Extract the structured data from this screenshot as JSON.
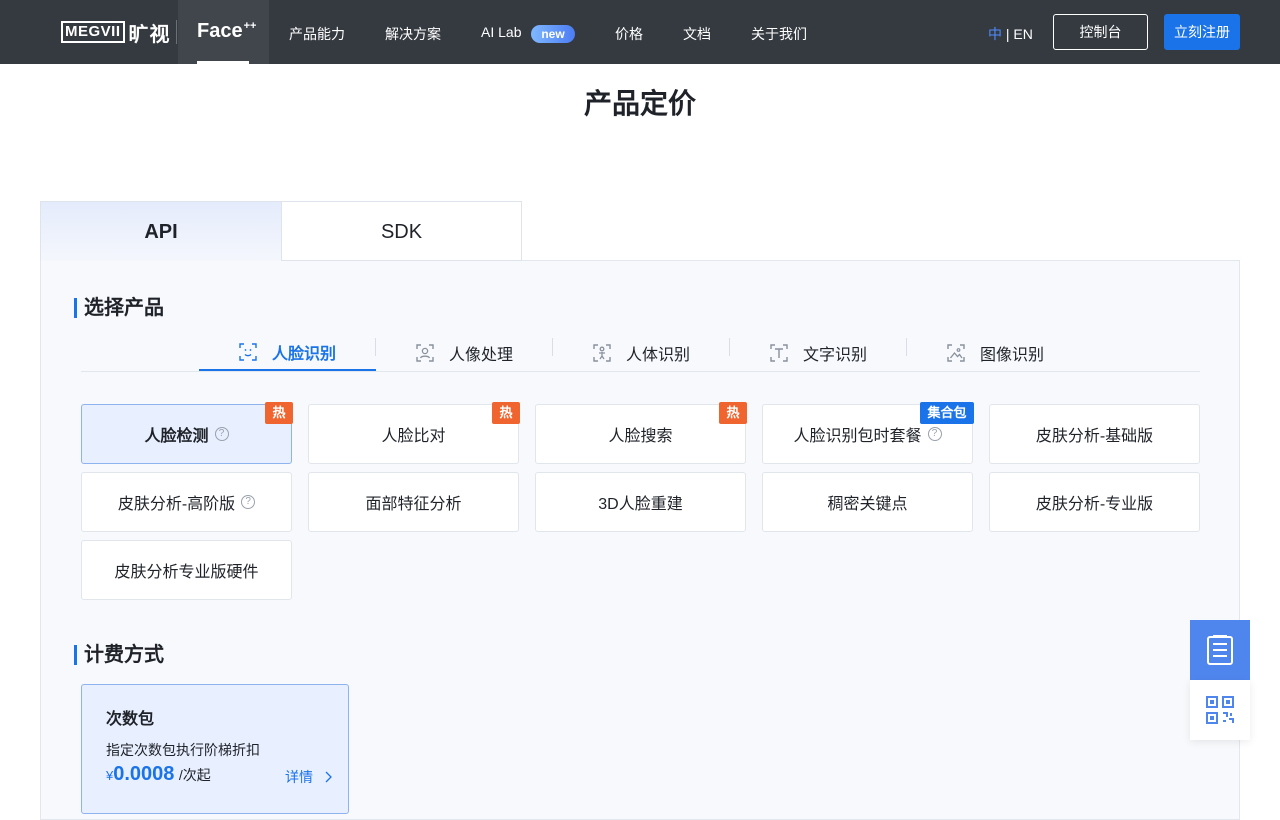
{
  "nav": {
    "logo_latin": "MEGVII",
    "logo_cn": "旷视",
    "product": "Face",
    "product_sup": "++",
    "items": [
      "产品能力",
      "解决方案",
      "AI Lab",
      "价格",
      "文档",
      "关于我们"
    ],
    "new_badge": "new",
    "lang_zh": "中",
    "lang_sep": " | ",
    "lang_en": "EN",
    "console": "控制台",
    "register": "立刻注册"
  },
  "page_title": "产品定价",
  "tabs": {
    "api": "API",
    "sdk": "SDK"
  },
  "select_product": {
    "title": "选择产品",
    "categories": [
      {
        "label": "人脸识别",
        "icon": "face-scan-icon",
        "active": true
      },
      {
        "label": "人像处理",
        "icon": "portrait-icon",
        "active": false
      },
      {
        "label": "人体识别",
        "icon": "body-icon",
        "active": false
      },
      {
        "label": "文字识别",
        "icon": "text-icon",
        "active": false
      },
      {
        "label": "图像识别",
        "icon": "image-icon",
        "active": false
      }
    ],
    "products": [
      {
        "label": "人脸检测",
        "badge": "热"
      },
      {
        "label": "人脸比对",
        "badge": "热"
      },
      {
        "label": "人脸搜索",
        "badge": "热"
      },
      {
        "label": "人脸识别包时套餐",
        "badge": "集合包"
      },
      {
        "label": "皮肤分析-基础版"
      },
      {
        "label": "皮肤分析-高阶版"
      },
      {
        "label": "面部特征分析"
      },
      {
        "label": "3D人脸重建"
      },
      {
        "label": "稠密关键点"
      },
      {
        "label": "皮肤分析-专业版"
      },
      {
        "label": "皮肤分析专业版硬件"
      }
    ]
  },
  "billing": {
    "title": "计费方式",
    "card_title": "次数包",
    "card_desc": "指定次数包执行阶梯折扣",
    "currency": "¥",
    "price": "0.0008",
    "unit": "/次起",
    "detail": "详情"
  },
  "colors": {
    "accent": "#1a73e8",
    "hot": "#f0652f",
    "nav_bg": "#343a40"
  }
}
